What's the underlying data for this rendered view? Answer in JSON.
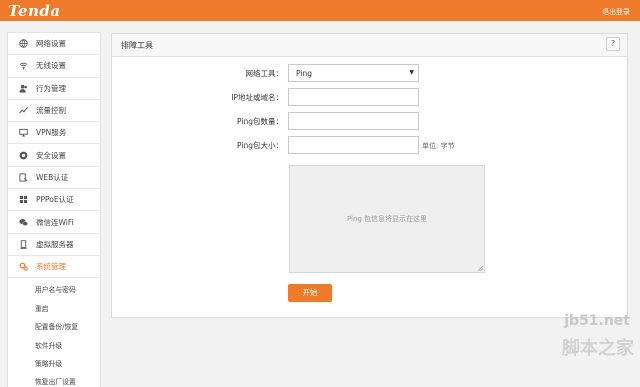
{
  "header": {
    "logo": "Tenda",
    "logout_label": "退出登录"
  },
  "sidebar": {
    "items": [
      {
        "label": "网络设置",
        "icon": "globe-icon"
      },
      {
        "label": "无线设置",
        "icon": "wifi-icon"
      },
      {
        "label": "行为管理",
        "icon": "users-icon"
      },
      {
        "label": "流量控制",
        "icon": "chart-icon"
      },
      {
        "label": "VPN服务",
        "icon": "vpn-icon"
      },
      {
        "label": "安全设置",
        "icon": "shield-icon"
      },
      {
        "label": "WEB认证",
        "icon": "web-auth-icon"
      },
      {
        "label": "PPPoE认证",
        "icon": "pppoe-icon"
      },
      {
        "label": "微信连WiFi",
        "icon": "wechat-icon"
      },
      {
        "label": "虚拟服务器",
        "icon": "server-icon"
      },
      {
        "label": "系统管理",
        "icon": "gear-icon"
      }
    ],
    "sub_items": [
      "用户名与密码",
      "重启",
      "配置备份/恢复",
      "软件升级",
      "策略升级",
      "恢复出厂设置"
    ]
  },
  "panel": {
    "title": "排障工具",
    "help_label": "?",
    "tool_label": "网络工具：",
    "tool_value": "Ping",
    "ip_label": "IP地址或域名：",
    "ip_value": "",
    "count_label": "Ping包数量：",
    "count_value": "",
    "size_label": "Ping包大小：",
    "size_value": "",
    "size_unit": "单位: 字节",
    "result_placeholder": "Ping 包信息将显示在这里",
    "start_label": "开始"
  },
  "watermark": {
    "url": "jb51.net",
    "text": "脚本之家"
  },
  "colors": {
    "accent": "#ee7a2a"
  }
}
